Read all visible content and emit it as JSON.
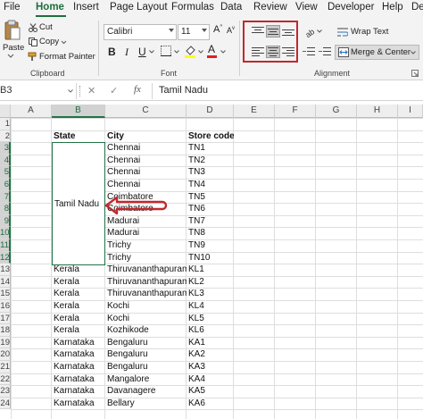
{
  "menu": {
    "tabs": [
      "File",
      "Home",
      "Insert",
      "Page Layout",
      "Formulas",
      "Data",
      "Review",
      "View",
      "Developer",
      "Help",
      "De"
    ],
    "active": "Home"
  },
  "clipboard": {
    "paste": "Paste",
    "cut": "Cut",
    "copy": "Copy",
    "format_painter": "Format Painter",
    "label": "Clipboard"
  },
  "font": {
    "name": "Calibri",
    "size": "11",
    "bold": "B",
    "italic": "I",
    "underline": "U",
    "font_color_glyph": "A",
    "label": "Font"
  },
  "alignment": {
    "wrap_text": "Wrap Text",
    "merge_center": "Merge & Center",
    "label": "Alignment"
  },
  "formula_bar": {
    "name_box": "B3",
    "cancel_glyph": "✕",
    "enter_glyph": "✓",
    "fx_glyph": "fx",
    "formula": "Tamil Nadu"
  },
  "sheet": {
    "columns": [
      "A",
      "B",
      "C",
      "D",
      "E",
      "F",
      "G",
      "H",
      "I"
    ],
    "selected_column": "B",
    "row_numbers": [
      "1",
      "2",
      "3",
      "4",
      "5",
      "6",
      "7",
      "8",
      "9",
      "10",
      "11",
      "12",
      "13",
      "14",
      "15",
      "16",
      "17",
      "18",
      "19",
      "20",
      "21",
      "22",
      "23",
      "24"
    ],
    "header": {
      "state": "State",
      "city": "City",
      "store_code": "Store code"
    },
    "merged_state": "Tamil Nadu",
    "tn_rows": [
      {
        "city": "Chennai",
        "code": "TN1"
      },
      {
        "city": "Chennai",
        "code": "TN2"
      },
      {
        "city": "Chennai",
        "code": "TN3"
      },
      {
        "city": "Chennai",
        "code": "TN4"
      },
      {
        "city": "Coimbatore",
        "code": "TN5"
      },
      {
        "city": "Coimbatore",
        "code": "TN6"
      },
      {
        "city": "Madurai",
        "code": "TN7"
      },
      {
        "city": "Madurai",
        "code": "TN8"
      },
      {
        "city": "Trichy",
        "code": "TN9"
      },
      {
        "city": "Trichy",
        "code": "TN10"
      }
    ],
    "other_rows": [
      {
        "state": "Kerala",
        "city": "Thiruvananthapuram",
        "code": "KL1"
      },
      {
        "state": "Kerala",
        "city": "Thiruvananthapuram",
        "code": "KL2"
      },
      {
        "state": "Kerala",
        "city": "Thiruvananthapuram",
        "code": "KL3"
      },
      {
        "state": "Kerala",
        "city": "Kochi",
        "code": "KL4"
      },
      {
        "state": "Kerala",
        "city": "Kochi",
        "code": "KL5"
      },
      {
        "state": "Kerala",
        "city": "Kozhikode",
        "code": "KL6"
      },
      {
        "state": "Karnataka",
        "city": "Bengaluru",
        "code": "KA1"
      },
      {
        "state": "Karnataka",
        "city": "Bengaluru",
        "code": "KA2"
      },
      {
        "state": "Karnataka",
        "city": "Bengaluru",
        "code": "KA3"
      },
      {
        "state": "Karnataka",
        "city": "Mangalore",
        "code": "KA4"
      },
      {
        "state": "Karnataka",
        "city": "Davanagere",
        "code": "KA5"
      },
      {
        "state": "Karnataka",
        "city": "Bellary",
        "code": "KA6"
      }
    ]
  },
  "colors": {
    "accent": "#217346",
    "highlight": "#c0282d"
  }
}
